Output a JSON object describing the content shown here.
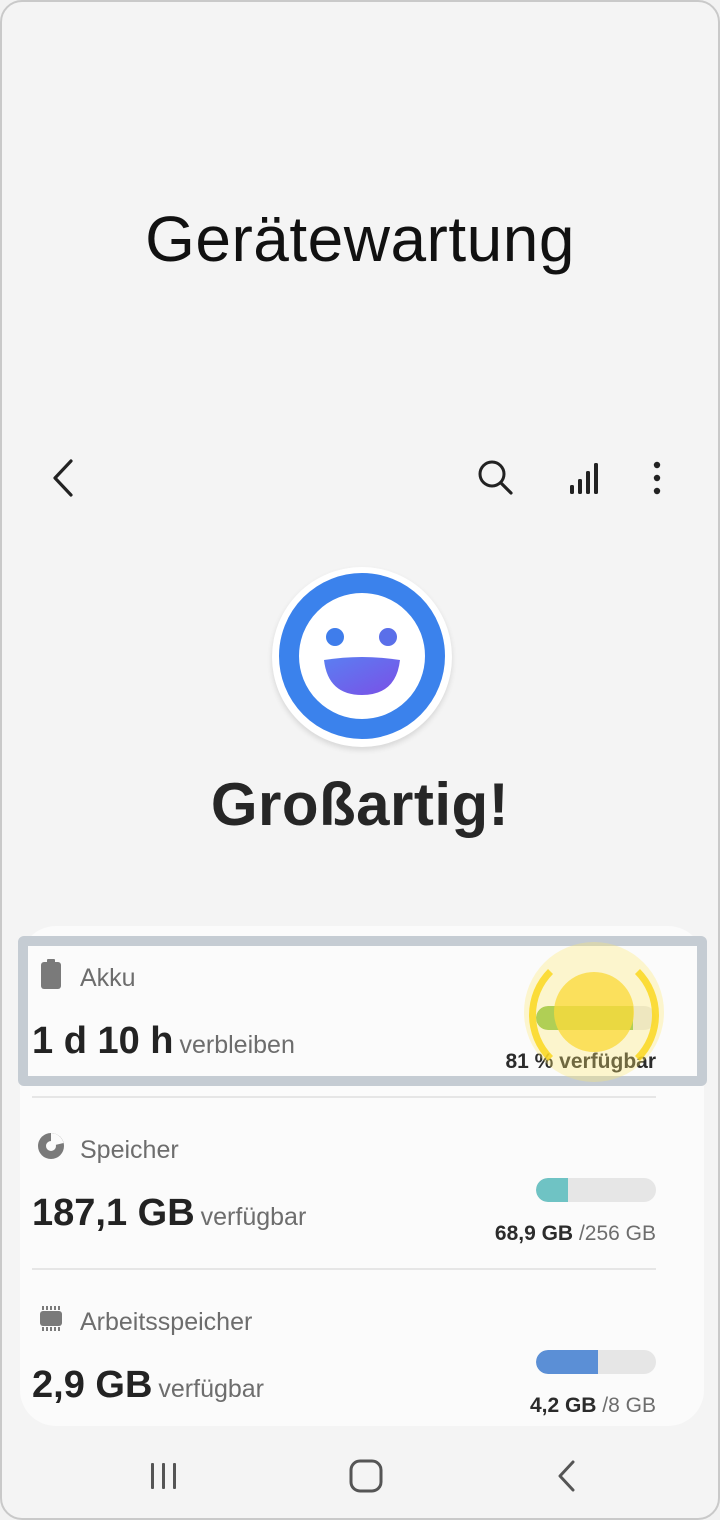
{
  "header": {
    "title": "Gerätewartung"
  },
  "toolbar": {
    "back_icon": "chevron-left-icon",
    "search_icon": "search-icon",
    "usage_icon": "signal-bars-icon",
    "more_icon": "more-vertical-icon"
  },
  "status": {
    "icon": "smiley-face-icon",
    "text": "Großartig!"
  },
  "items": [
    {
      "icon": "battery-icon",
      "label": "Akku",
      "value": "1 d 10 h",
      "value_suffix": "verbleiben",
      "bar_fraction": 0.81,
      "bar_color": "#8bc34a",
      "stat_strong": "81 % verfügbar",
      "stat_weak": ""
    },
    {
      "icon": "storage-pie-icon",
      "label": "Speicher",
      "value": "187,1 GB",
      "value_suffix": "verfügbar",
      "bar_fraction": 0.27,
      "bar_color": "#6fc3c4",
      "stat_strong": "68,9 GB",
      "stat_weak": " /256 GB"
    },
    {
      "icon": "memory-chip-icon",
      "label": "Arbeitsspeicher",
      "value": "2,9 GB",
      "value_suffix": "verfügbar",
      "bar_fraction": 0.52,
      "bar_color": "#5b8fd6",
      "stat_strong": "4,2 GB",
      "stat_weak": " /8 GB"
    }
  ],
  "navbar": {
    "recents_icon": "recents-icon",
    "home_icon": "home-icon",
    "back_icon": "back-icon"
  }
}
